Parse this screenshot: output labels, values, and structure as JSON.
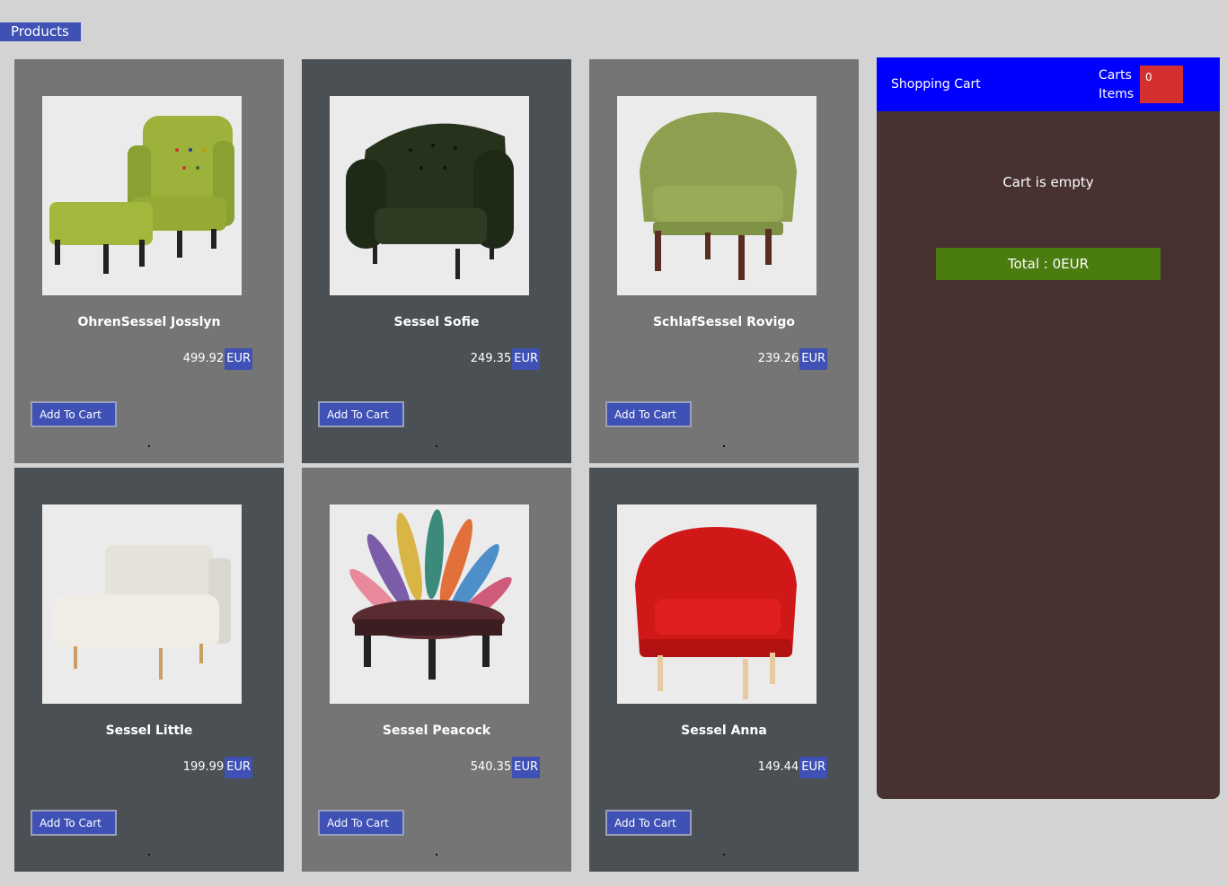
{
  "header": {
    "products_label": "Products"
  },
  "products": [
    {
      "name": "OhrenSessel Josslyn",
      "price": "499.92",
      "currency": "EUR",
      "button": "Add To Cart",
      "image": "green-wingback-chair-with-ottoman"
    },
    {
      "name": "Sessel Sofie",
      "price": "249.35",
      "currency": "EUR",
      "button": "Add To Cart",
      "image": "dark-green-tufted-armchair"
    },
    {
      "name": "SchlafSessel Rovigo",
      "price": "239.26",
      "currency": "EUR",
      "button": "Add To Cart",
      "image": "olive-tub-chair"
    },
    {
      "name": "Sessel Little",
      "price": "199.99",
      "currency": "EUR",
      "button": "Add To Cart",
      "image": "white-sleeper-chair"
    },
    {
      "name": "Sessel Peacock",
      "price": "540.35",
      "currency": "EUR",
      "button": "Add To Cart",
      "image": "patchwork-peacock-chair"
    },
    {
      "name": "Sessel Anna",
      "price": "149.44",
      "currency": "EUR",
      "button": "Add To Cart",
      "image": "red-tub-chair"
    }
  ],
  "cart": {
    "title": "Shopping Cart",
    "items_label": "Carts Items",
    "count": "0",
    "empty_text": "Cart is empty",
    "total": "Total : 0EUR"
  },
  "colors": {
    "background": "#d3d3d3",
    "accent": "#3f51b5",
    "card_light": "#757575",
    "card_dark": "#4a5054",
    "cart_header": "#0000ff",
    "cart_body": "#473131",
    "cart_badge": "#d32f2f",
    "total_bar": "#4a7c10"
  }
}
